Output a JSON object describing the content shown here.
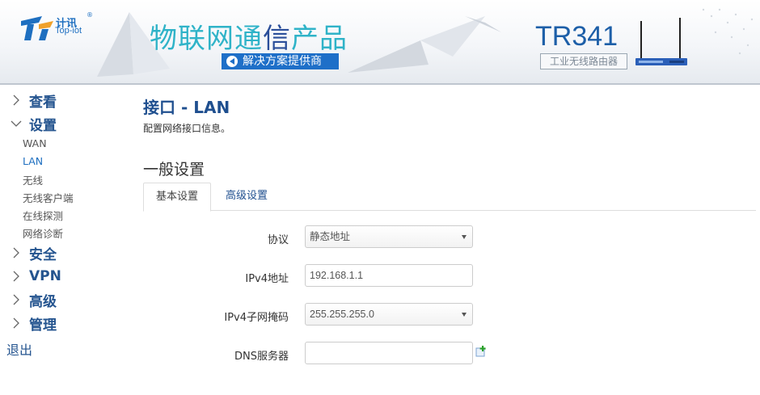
{
  "header": {
    "logo_name": "计讯",
    "logo_sub": "Top-iot",
    "logo_reg": "®",
    "slogan_part1": "物联网通",
    "slogan_accent": "信",
    "slogan_part2": "产品",
    "tagline": "解决方案提供商",
    "model": "TR341",
    "model_sub": "工业无线路由器"
  },
  "sidebar": {
    "groups": [
      {
        "label": "查看",
        "expanded": false
      },
      {
        "label": "设置",
        "expanded": true
      },
      {
        "label": "安全",
        "expanded": false
      },
      {
        "label": "VPN",
        "expanded": false
      },
      {
        "label": "高级",
        "expanded": false
      },
      {
        "label": "管理",
        "expanded": false
      }
    ],
    "settings_items": [
      "WAN",
      "LAN",
      "无线",
      "无线客户端",
      "在线探测",
      "网络诊断"
    ],
    "active_item": "LAN",
    "logout": "退出"
  },
  "main": {
    "title": "接口 - LAN",
    "description": "配置网络接口信息。",
    "section_title": "一般设置",
    "tabs": [
      {
        "label": "基本设置",
        "active": true
      },
      {
        "label": "高级设置",
        "active": false
      }
    ],
    "fields": [
      {
        "label": "协议",
        "type": "select",
        "value": "静态地址"
      },
      {
        "label": "IPv4地址",
        "type": "text",
        "value": "192.168.1.1"
      },
      {
        "label": "IPv4子网掩码",
        "type": "select",
        "value": "255.255.255.0"
      },
      {
        "label": "DNS服务器",
        "type": "text",
        "value": ""
      }
    ]
  },
  "colors": {
    "nav_blue": "#24548f",
    "link_blue": "#1e6fc0",
    "brand_teal": "#2fb3c8"
  },
  "icons": [
    "chevron-right-icon",
    "chevron-down-icon",
    "add-field-icon",
    "play-icon",
    "router-icon"
  ]
}
